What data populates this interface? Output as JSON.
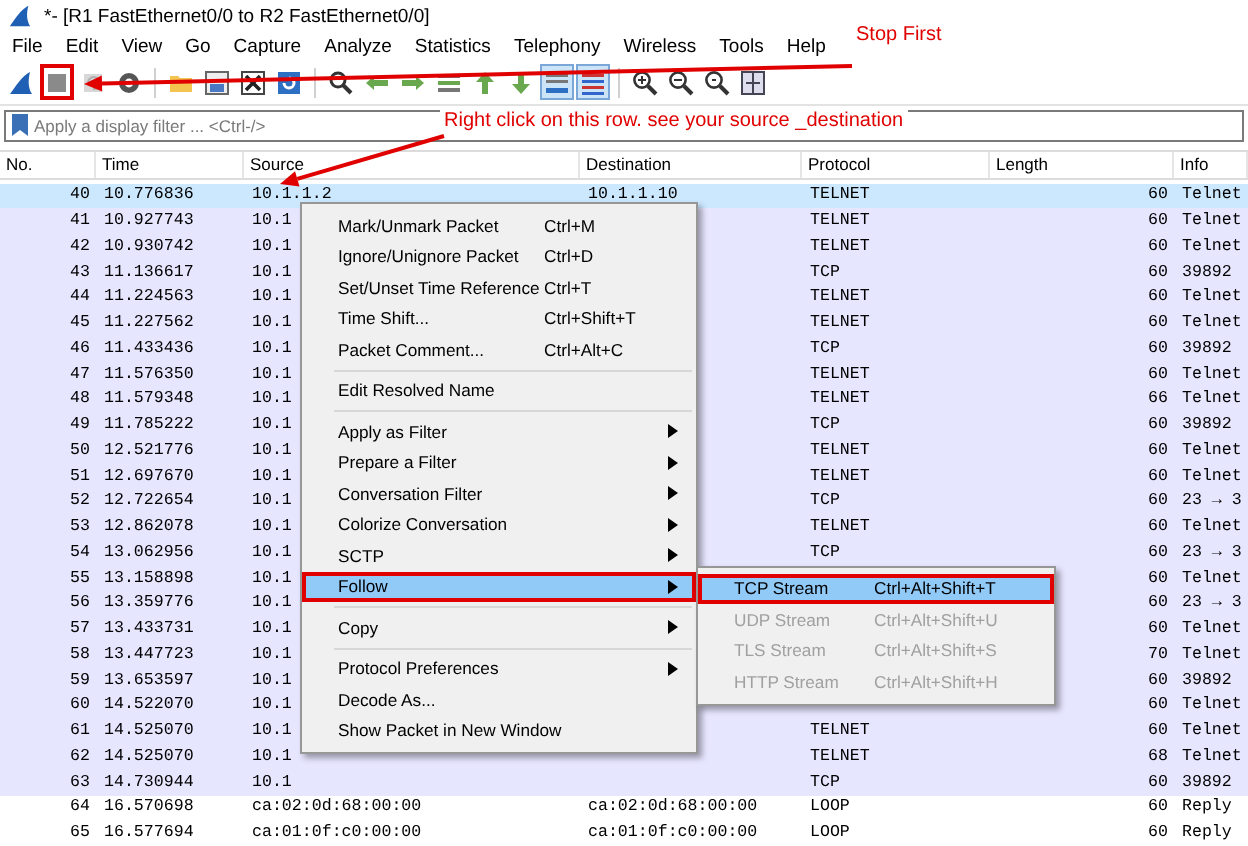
{
  "window": {
    "title": "*- [R1 FastEthernet0/0 to R2 FastEthernet0/0]"
  },
  "menu": [
    "File",
    "Edit",
    "View",
    "Go",
    "Capture",
    "Analyze",
    "Statistics",
    "Telephony",
    "Wireless",
    "Tools",
    "Help"
  ],
  "filter": {
    "placeholder": "Apply a display filter ... <Ctrl-/>"
  },
  "table": {
    "columns": [
      "No.",
      "Time",
      "Source",
      "Destination",
      "Protocol",
      "Length",
      "Info"
    ],
    "rows": [
      {
        "no": "40",
        "time": "10.776836",
        "source": "10.1.1.2",
        "destination": "10.1.1.10",
        "protocol": "TELNET",
        "length": "60",
        "info": "Telnet",
        "selected": true
      },
      {
        "no": "41",
        "time": "10.927743",
        "source": "10.1",
        "protocol": "TELNET",
        "length": "60",
        "info": "Telnet",
        "color": "#e7e6ff",
        "selected": false
      },
      {
        "no": "42",
        "time": "10.930742",
        "source": "10.1",
        "protocol": "TELNET",
        "length": "60",
        "info": "Telnet",
        "color": "#e7e6ff",
        "selected": false
      },
      {
        "no": "43",
        "time": "11.136617",
        "source": "10.1",
        "protocol": "TCP",
        "length": "60",
        "info": "39892",
        "color": "#e7e6ff",
        "selected": false
      },
      {
        "no": "44",
        "time": "11.224563",
        "source": "10.1",
        "protocol": "TELNET",
        "length": "60",
        "info": "Telnet",
        "color": "#e7e6ff",
        "selected": false
      },
      {
        "no": "45",
        "time": "11.227562",
        "source": "10.1",
        "protocol": "TELNET",
        "length": "60",
        "info": "Telnet",
        "color": "#e7e6ff",
        "selected": false
      },
      {
        "no": "46",
        "time": "11.433436",
        "source": "10.1",
        "protocol": "TCP",
        "length": "60",
        "info": "39892",
        "color": "#e7e6ff",
        "selected": false
      },
      {
        "no": "47",
        "time": "11.576350",
        "source": "10.1",
        "protocol": "TELNET",
        "length": "60",
        "info": "Telnet",
        "color": "#e7e6ff",
        "selected": false
      },
      {
        "no": "48",
        "time": "11.579348",
        "source": "10.1",
        "protocol": "TELNET",
        "length": "66",
        "info": "Telnet",
        "color": "#e7e6ff",
        "selected": false
      },
      {
        "no": "49",
        "time": "11.785222",
        "source": "10.1",
        "protocol": "TCP",
        "length": "60",
        "info": "39892",
        "color": "#e7e6ff",
        "selected": false
      },
      {
        "no": "50",
        "time": "12.521776",
        "source": "10.1",
        "protocol": "TELNET",
        "length": "60",
        "info": "Telnet",
        "color": "#e7e6ff",
        "selected": false
      },
      {
        "no": "51",
        "time": "12.697670",
        "source": "10.1",
        "protocol": "TELNET",
        "length": "60",
        "info": "Telnet",
        "color": "#e7e6ff",
        "selected": false
      },
      {
        "no": "52",
        "time": "12.722654",
        "source": "10.1",
        "protocol": "TCP",
        "length": "60",
        "info": "23 → 3",
        "color": "#e7e6ff",
        "selected": false
      },
      {
        "no": "53",
        "time": "12.862078",
        "source": "10.1",
        "protocol": "TELNET",
        "length": "60",
        "info": "Telnet",
        "color": "#e7e6ff",
        "selected": false
      },
      {
        "no": "54",
        "time": "13.062956",
        "source": "10.1",
        "protocol": "TCP",
        "length": "60",
        "info": "23 → 3",
        "color": "#e7e6ff",
        "selected": false
      },
      {
        "no": "55",
        "time": "13.158898",
        "source": "10.1",
        "length": "60",
        "info": "Telnet",
        "color": "#e7e6ff",
        "selected": false
      },
      {
        "no": "56",
        "time": "13.359776",
        "source": "10.1",
        "length": "60",
        "info": "23 → 3",
        "color": "#e7e6ff",
        "selected": false
      },
      {
        "no": "57",
        "time": "13.433731",
        "source": "10.1",
        "length": "60",
        "info": "Telnet",
        "color": "#e7e6ff",
        "selected": false
      },
      {
        "no": "58",
        "time": "13.447723",
        "source": "10.1",
        "length": "70",
        "info": "Telnet",
        "color": "#e7e6ff",
        "selected": false
      },
      {
        "no": "59",
        "time": "13.653597",
        "source": "10.1",
        "length": "60",
        "info": "39892",
        "color": "#e7e6ff",
        "selected": false
      },
      {
        "no": "60",
        "time": "14.522070",
        "source": "10.1",
        "length": "60",
        "info": "Telnet",
        "color": "#e7e6ff",
        "selected": false
      },
      {
        "no": "61",
        "time": "14.525070",
        "source": "10.1",
        "protocol": "TELNET",
        "length": "60",
        "info": "Telnet",
        "color": "#e7e6ff",
        "selected": false
      },
      {
        "no": "62",
        "time": "14.525070",
        "source": "10.1",
        "protocol": "TELNET",
        "length": "68",
        "info": "Telnet",
        "color": "#e7e6ff",
        "selected": false
      },
      {
        "no": "63",
        "time": "14.730944",
        "source": "10.1",
        "protocol": "TCP",
        "length": "60",
        "info": "39892",
        "color": "#e7e6ff",
        "selected": false
      },
      {
        "no": "64",
        "time": "16.570698",
        "source": "ca:02:0d:68:00:00",
        "destination": "ca:02:0d:68:00:00",
        "protocol": "LOOP",
        "length": "60",
        "info": "Reply",
        "color": "#ffffff",
        "selected": false
      },
      {
        "no": "65",
        "time": "16.577694",
        "source": "ca:01:0f:c0:00:00",
        "destination": "ca:01:0f:c0:00:00",
        "protocol": "LOOP",
        "length": "60",
        "info": "Reply",
        "color": "#ffffff",
        "selected": false
      }
    ]
  },
  "context_menu": {
    "items": [
      {
        "kind": "item",
        "label": "Mark/Unmark Packet",
        "shortcut": "Ctrl+M",
        "submenu": false,
        "selected": false
      },
      {
        "kind": "item",
        "label": "Ignore/Unignore Packet",
        "shortcut": "Ctrl+D",
        "submenu": false,
        "selected": false
      },
      {
        "kind": "item",
        "label": "Set/Unset Time Reference",
        "shortcut": "Ctrl+T",
        "submenu": false,
        "selected": false
      },
      {
        "kind": "item",
        "label": "Time Shift...",
        "shortcut": "Ctrl+Shift+T",
        "submenu": false,
        "selected": false
      },
      {
        "kind": "item",
        "label": "Packet Comment...",
        "shortcut": "Ctrl+Alt+C",
        "submenu": false,
        "selected": false
      },
      {
        "kind": "separator"
      },
      {
        "kind": "item",
        "label": "Edit Resolved Name",
        "submenu": false,
        "selected": false
      },
      {
        "kind": "separator"
      },
      {
        "kind": "item",
        "label": "Apply as Filter",
        "submenu": true,
        "selected": false
      },
      {
        "kind": "item",
        "label": "Prepare a Filter",
        "submenu": true,
        "selected": false
      },
      {
        "kind": "item",
        "label": "Conversation Filter",
        "submenu": true,
        "selected": false
      },
      {
        "kind": "item",
        "label": "Colorize Conversation",
        "submenu": true,
        "selected": false
      },
      {
        "kind": "item",
        "label": "SCTP",
        "submenu": true,
        "selected": false
      },
      {
        "kind": "item",
        "label": "Follow",
        "submenu": true,
        "selected": true,
        "outlined": true
      },
      {
        "kind": "separator"
      },
      {
        "kind": "item",
        "label": "Copy",
        "submenu": true,
        "selected": false
      },
      {
        "kind": "separator"
      },
      {
        "kind": "item",
        "label": "Protocol Preferences",
        "submenu": true,
        "selected": false
      },
      {
        "kind": "item",
        "label": "Decode As...",
        "submenu": false,
        "selected": false
      },
      {
        "kind": "item",
        "label": "Show Packet in New Window",
        "submenu": false,
        "selected": false
      }
    ]
  },
  "submenu": {
    "items": [
      {
        "label": "TCP Stream",
        "shortcut": "Ctrl+Alt+Shift+T",
        "disabled": false,
        "selected": true,
        "outlined": true
      },
      {
        "label": "UDP Stream",
        "shortcut": "Ctrl+Alt+Shift+U",
        "disabled": true,
        "selected": false
      },
      {
        "label": "TLS Stream",
        "shortcut": "Ctrl+Alt+Shift+S",
        "disabled": true,
        "selected": false
      },
      {
        "label": "HTTP Stream",
        "shortcut": "Ctrl+Alt+Shift+H",
        "disabled": true,
        "selected": false
      }
    ]
  },
  "annotations": [
    {
      "text": "Stop First"
    },
    {
      "text": "Right click on this row. see  your source _destination"
    }
  ]
}
